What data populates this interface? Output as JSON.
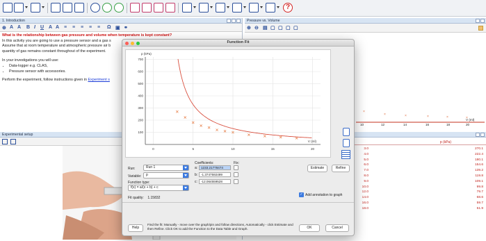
{
  "toolbar": {
    "help_icon": "question-icon"
  },
  "intro": {
    "title": "1. Introduction",
    "question": "What is the relationship between gas pressure and volume when temperature is kept constant?",
    "para1": "In this activity you are going to use a pressure sensor and a gas s",
    "para2": "Assume that at room temperature and atmospheric pressure air b",
    "para3": "quantity of gas remains constant throughout of the experiment.",
    "uses_intro": "In your investigations  you will use:",
    "uses": [
      "Data-logger e.g. CLAS,",
      "Pressure sensor with accessories."
    ],
    "perform_text": "Perform the experiment, follow instructions given in",
    "link_text": "Experiment s"
  },
  "setup": {
    "title": "Experimental setup"
  },
  "graph_panel": {
    "title": "Pressure vs. Volume",
    "x_ticks": [
      "10",
      "12",
      "14",
      "16",
      "18",
      "20"
    ],
    "x_label": "V (ml)"
  },
  "table_panel": {
    "header_p": "p (kPa)",
    "volumes": [
      "3.0",
      "4.0",
      "5.0",
      "6.0",
      "7.0",
      "8.0",
      "9.0",
      "10.0",
      "12.0",
      "14.0",
      "16.0",
      "18.0"
    ],
    "pressures": [
      "270.1",
      "222.4",
      "180.1",
      "154.6",
      "139.2",
      "119.8",
      "109.1",
      "99.8",
      "79.7",
      "68.6",
      "59.7",
      "51.9"
    ]
  },
  "dialog": {
    "title": "Function Fit",
    "run_label": "Run:",
    "run_value": "Run 1",
    "variable_label": "Variable:",
    "variable_value": "p",
    "function_type_label": "Function type:",
    "function_value": "f(x) = a/(x + b) + c",
    "fit_quality_label": "Fit quality:",
    "fit_quality_value": "1.15832",
    "coefficients_label": "Coefficients:",
    "fix_label": "Fix:",
    "coef_a_label": "a:",
    "coef_a": "1233.21778474",
    "coef_b_label": "b:",
    "coef_b": "-1.3747592499",
    "coef_c_label": "c:",
    "coef_c": "-12.064559528",
    "estimate_label": "Estimate",
    "refine_label": "Refine",
    "annotation_label": "Add annotation to graph",
    "help_label": "Help",
    "help_text": "Find the fit: Manually - move over the graph/pin and follow directions, Automatically - click Estimate and then Refine. Click OK to add the Function to the Data Table and Graph.",
    "ok_label": "OK",
    "cancel_label": "Cancel"
  },
  "chart_data": {
    "type": "scatter",
    "ylabel": "p (kPa)",
    "xlabel": "V (ml)",
    "x_ticks": [
      "0",
      "5",
      "10",
      "15",
      "20"
    ],
    "y_ticks": [
      "100",
      "200",
      "300",
      "400",
      "500",
      "600",
      "700"
    ],
    "xlim": [
      -1,
      21
    ],
    "ylim": [
      0,
      720
    ],
    "series": [
      {
        "x": [
          3.0,
          4.0,
          5.0,
          6.0,
          7.0,
          8.0,
          9.0,
          10.0,
          12.0,
          14.0,
          16.0,
          18.0
        ],
        "values": [
          270.1,
          222.4,
          180.1,
          154.6,
          139.2,
          119.8,
          109.1,
          99.8,
          79.7,
          68.6,
          59.7,
          51.9
        ]
      }
    ],
    "fit_line": {
      "color": "#d9503f"
    },
    "point_color": "#e8804a",
    "grid": true
  }
}
